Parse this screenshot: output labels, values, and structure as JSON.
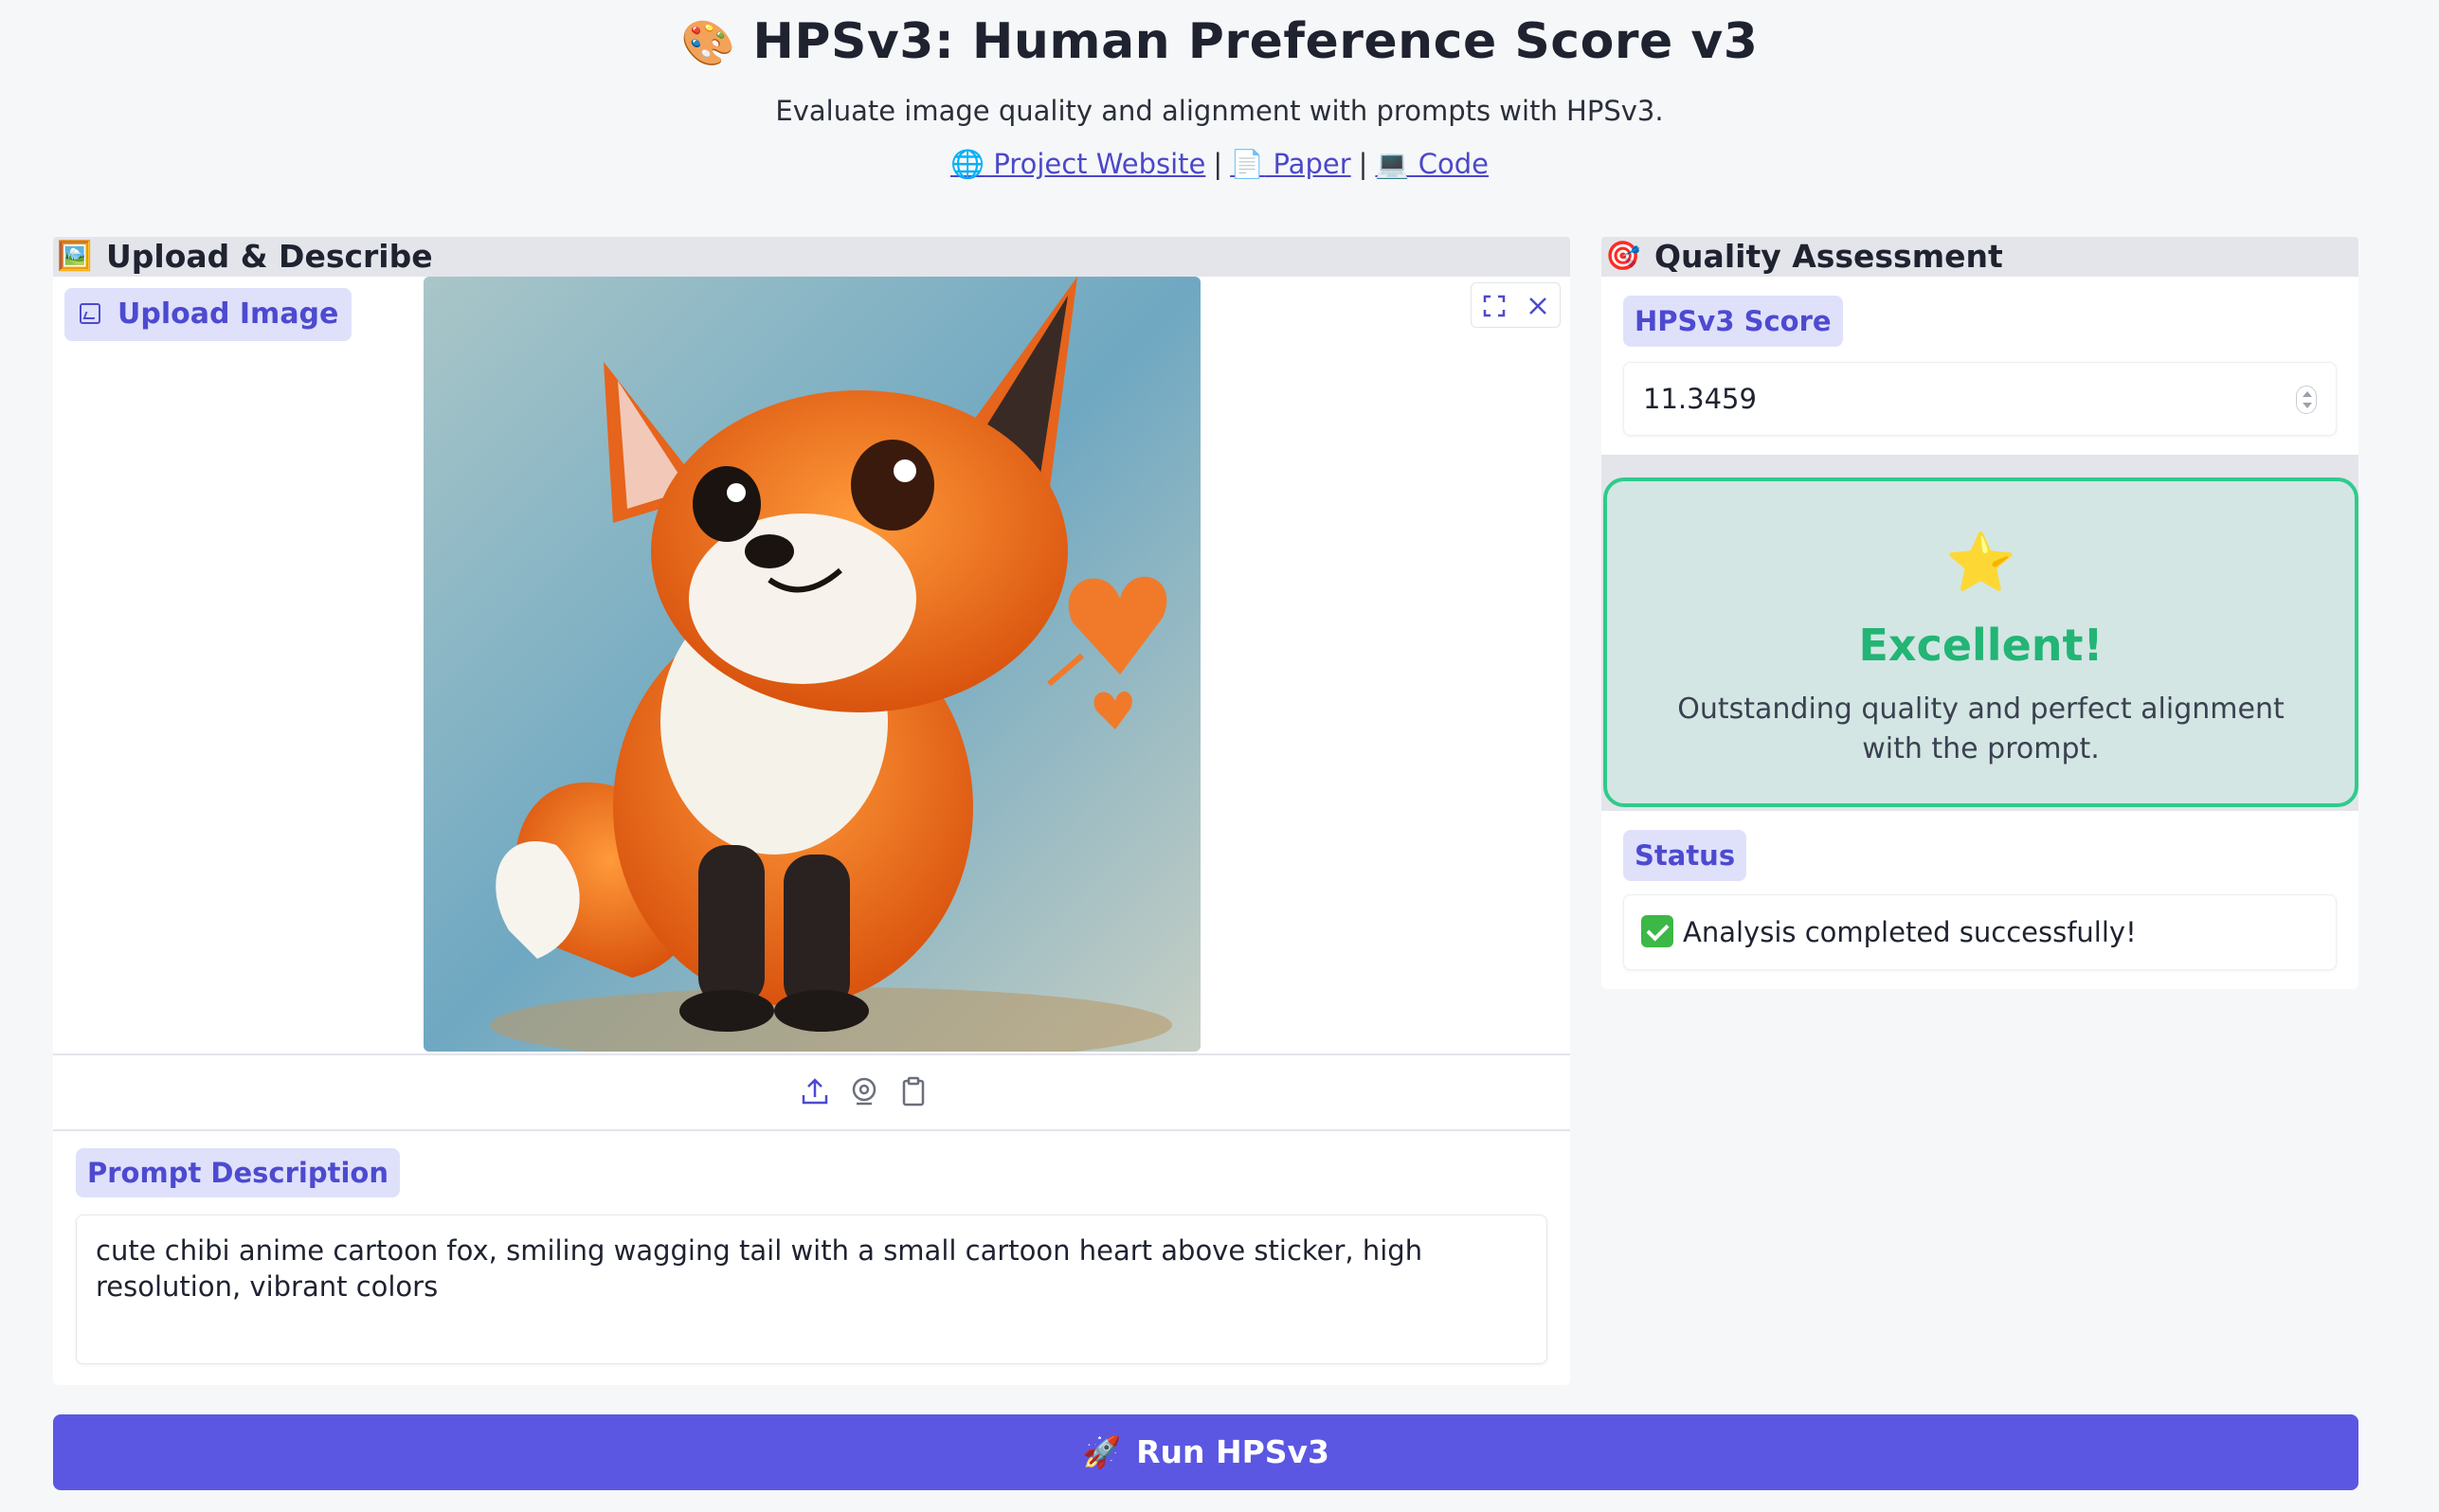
{
  "header": {
    "title_emoji": "🎨",
    "title": "HPSv3: Human Preference Score v3",
    "subtitle": "Evaluate image quality and alignment with prompts with HPSv3.",
    "links": [
      {
        "icon": "🌐",
        "label": " Project Website"
      },
      {
        "icon": "📄",
        "label": " Paper"
      },
      {
        "icon": "💻",
        "label": " Code"
      }
    ],
    "separator": "|"
  },
  "left_panel": {
    "icon": "🖼️",
    "title": "Upload & Describe",
    "upload_label": "Upload Image",
    "image_tools": [
      "fullscreen-icon",
      "close-icon"
    ],
    "source_icons": [
      "upload-icon",
      "webcam-icon",
      "clipboard-icon"
    ],
    "prompt_label": "Prompt Description",
    "prompt_value": "cute chibi anime cartoon fox, smiling wagging tail with a small cartoon heart above sticker, high resolution, vibrant colors"
  },
  "right_panel": {
    "icon": "🎯",
    "title": "Quality Assessment",
    "score_label": "HPSv3 Score",
    "score_value": "11.3459",
    "result": {
      "icon": "⭐",
      "headline": "Excellent!",
      "description": "Outstanding quality and perfect alignment with the prompt.",
      "accent_color": "#2fcb8d"
    },
    "status_label": "Status",
    "status_value": "Analysis completed successfully!"
  },
  "run_button": {
    "icon": "🚀",
    "label": "Run HPSv3",
    "color": "#5b57e3"
  }
}
